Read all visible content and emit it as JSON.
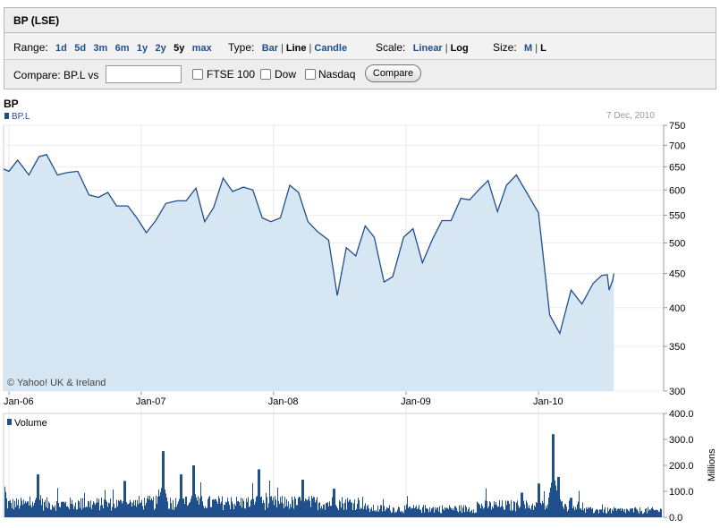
{
  "header": {
    "title": "BP (LSE)"
  },
  "range": {
    "label": "Range:",
    "options": [
      "1d",
      "5d",
      "3m",
      "6m",
      "1y",
      "2y",
      "5y",
      "max"
    ],
    "selected": "5y"
  },
  "type": {
    "label": "Type:",
    "options": [
      "Bar",
      "Line",
      "Candle"
    ],
    "selected": "Line"
  },
  "scale": {
    "label": "Scale:",
    "options": [
      "Linear",
      "Log"
    ],
    "selected": "Log"
  },
  "size": {
    "label": "Size:",
    "options": [
      "M",
      "L"
    ],
    "selected": "L"
  },
  "compare": {
    "label": "Compare: BP.L vs",
    "input_value": "",
    "checkboxes": [
      {
        "label": "FTSE 100",
        "checked": false
      },
      {
        "label": "Dow",
        "checked": false
      },
      {
        "label": "Nasdaq",
        "checked": false
      }
    ],
    "button_label": "Compare"
  },
  "chart_header": {
    "title": "BP",
    "date": "7 Dec, 2010"
  },
  "colors": {
    "line": "#1f4f8c",
    "area": "#d6e6f2",
    "bars": "#1f4f8c"
  },
  "chart_data": [
    {
      "type": "area",
      "legend": [
        "BP.L"
      ],
      "scale": "log",
      "grid": true,
      "ylim": [
        300,
        750
      ],
      "yticks": [
        300,
        350,
        400,
        450,
        500,
        550,
        600,
        650,
        700,
        750
      ],
      "xticks": [
        "Jan-06",
        "Jan-07",
        "Jan-08",
        "Jan-09",
        "Jan-10"
      ],
      "watermark": "© Yahoo! UK & Ireland",
      "series": [
        {
          "name": "BP.L",
          "points": [
            [
              "2005-12-10",
              645
            ],
            [
              "2006-01-01",
              640
            ],
            [
              "2006-01-25",
              665
            ],
            [
              "2006-02-25",
              632
            ],
            [
              "2006-03-25",
              673
            ],
            [
              "2006-04-15",
              678
            ],
            [
              "2006-05-15",
              632
            ],
            [
              "2006-06-10",
              637
            ],
            [
              "2006-07-10",
              640
            ],
            [
              "2006-08-10",
              590
            ],
            [
              "2006-09-05",
              585
            ],
            [
              "2006-10-01",
              595
            ],
            [
              "2006-10-25",
              568
            ],
            [
              "2006-11-25",
              568
            ],
            [
              "2006-12-20",
              545
            ],
            [
              "2007-01-15",
              518
            ],
            [
              "2007-02-10",
              540
            ],
            [
              "2007-03-10",
              573
            ],
            [
              "2007-04-10",
              578
            ],
            [
              "2007-05-05",
              578
            ],
            [
              "2007-06-01",
              604
            ],
            [
              "2007-06-25",
              538
            ],
            [
              "2007-07-20",
              565
            ],
            [
              "2007-08-15",
              625
            ],
            [
              "2007-09-10",
              597
            ],
            [
              "2007-10-10",
              606
            ],
            [
              "2007-11-05",
              600
            ],
            [
              "2007-12-01",
              545
            ],
            [
              "2007-12-25",
              538
            ],
            [
              "2008-01-20",
              545
            ],
            [
              "2008-02-15",
              610
            ],
            [
              "2008-03-10",
              595
            ],
            [
              "2008-04-05",
              538
            ],
            [
              "2008-05-01",
              520
            ],
            [
              "2008-06-01",
              505
            ],
            [
              "2008-06-25",
              417
            ],
            [
              "2008-07-20",
              492
            ],
            [
              "2008-08-15",
              478
            ],
            [
              "2008-09-10",
              530
            ],
            [
              "2008-10-05",
              510
            ],
            [
              "2008-11-01",
              437
            ],
            [
              "2008-11-25",
              445
            ],
            [
              "2008-12-25",
              510
            ],
            [
              "2009-01-20",
              525
            ],
            [
              "2009-02-15",
              467
            ],
            [
              "2009-03-15",
              507
            ],
            [
              "2009-04-10",
              540
            ],
            [
              "2009-05-05",
              540
            ],
            [
              "2009-06-01",
              583
            ],
            [
              "2009-06-25",
              580
            ],
            [
              "2009-07-20",
              600
            ],
            [
              "2009-08-15",
              620
            ],
            [
              "2009-09-10",
              557
            ],
            [
              "2009-10-05",
              610
            ],
            [
              "2009-11-01",
              632
            ],
            [
              "2010-01-01",
              555
            ],
            [
              "2010-02-01",
              390
            ],
            [
              "2010-03-01",
              366
            ],
            [
              "2010-04-01",
              425
            ],
            [
              "2010-05-01",
              405
            ],
            [
              "2010-06-01",
              435
            ],
            [
              "2010-06-25",
              447
            ],
            [
              "2010-07-10",
              448
            ],
            [
              "2010-07-15",
              425
            ],
            [
              "2010-07-25",
              440
            ],
            [
              "2010-07-28",
              450
            ]
          ]
        }
      ]
    },
    {
      "type": "bar",
      "legend": [
        "Volume"
      ],
      "ylim": [
        0,
        400
      ],
      "yticks": [
        0.0,
        100.0,
        200.0,
        300.0,
        400.0
      ],
      "ylabel": "Millions",
      "series": [
        {
          "name": "Volume",
          "peaks": [
            [
              "2005-12-10",
              375
            ],
            [
              "2006-03-20",
              165
            ],
            [
              "2006-11-15",
              140
            ],
            [
              "2007-03-01",
              255
            ],
            [
              "2007-04-20",
              165
            ],
            [
              "2007-05-25",
              200
            ],
            [
              "2007-11-20",
              185
            ],
            [
              "2008-03-20",
              145
            ],
            [
              "2008-06-15",
              110
            ],
            [
              "2009-11-15",
              95
            ],
            [
              "2010-01-01",
              130
            ],
            [
              "2010-02-10",
              320
            ],
            [
              "2010-02-25",
              155
            ],
            [
              "2010-04-01",
              75
            ],
            [
              "2010-06-20",
              30
            ]
          ]
        }
      ]
    }
  ]
}
